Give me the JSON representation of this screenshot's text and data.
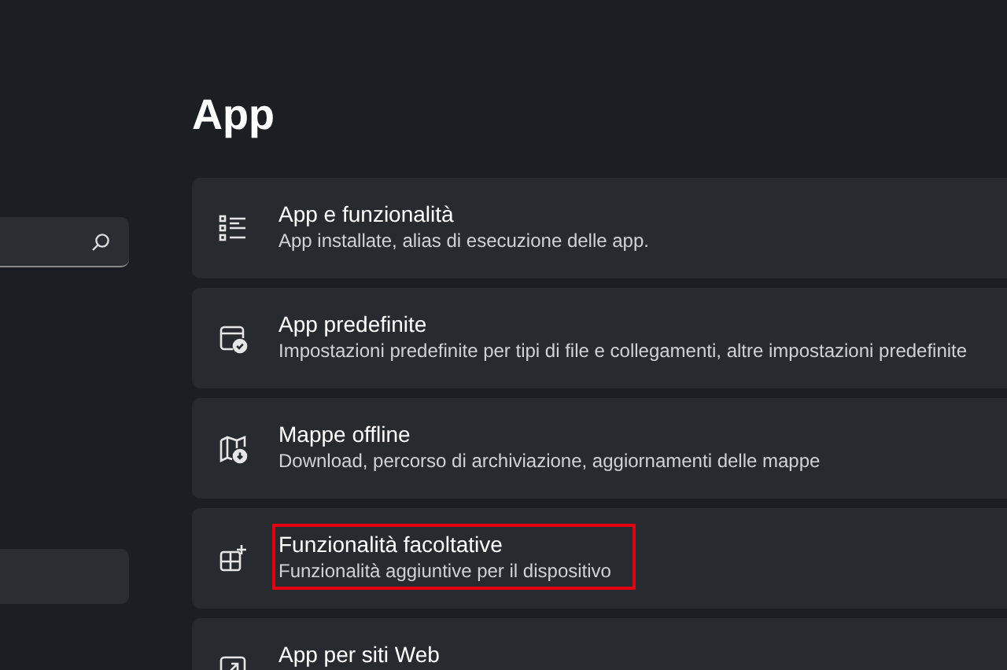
{
  "page": {
    "title": "App"
  },
  "items": [
    {
      "kind": "list",
      "title": "App e funzionalità",
      "subtitle": "App installate, alias di esecuzione delle app.",
      "highlighted": false
    },
    {
      "kind": "default",
      "title": "App predefinite",
      "subtitle": "Impostazioni predefinite per tipi di file e collegamenti, altre impostazioni predefinite",
      "highlighted": false
    },
    {
      "kind": "map",
      "title": "Mappe offline",
      "subtitle": "Download, percorso di archiviazione, aggiornamenti delle mappe",
      "highlighted": false
    },
    {
      "kind": "addgrid",
      "title": "Funzionalità facoltative",
      "subtitle": "Funzionalità aggiuntive per il dispositivo",
      "highlighted": true
    },
    {
      "kind": "web",
      "title": "App per siti Web",
      "highlighted": false
    }
  ]
}
